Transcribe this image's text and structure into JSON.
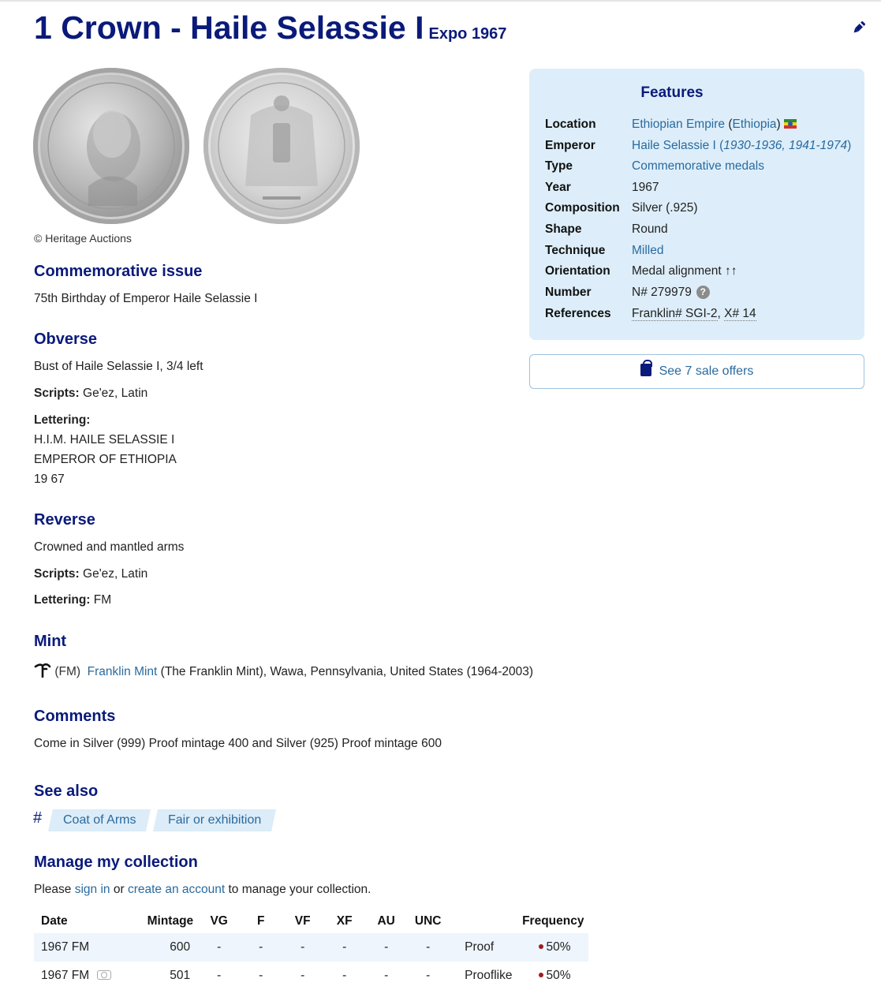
{
  "page": {
    "title": "1 Crown - Haile Selassie I",
    "subtitle": "Expo 1967"
  },
  "images": {
    "credit": "© Heritage Auctions"
  },
  "commemorative": {
    "heading": "Commemorative issue",
    "text": "75th Birthday of Emperor Haile Selassie I"
  },
  "obverse": {
    "heading": "Obverse",
    "description": "Bust of Haile Selassie I, 3/4 left",
    "scripts_label": "Scripts:",
    "scripts": "Ge'ez, Latin",
    "lettering_label": "Lettering:",
    "lettering_lines": [
      "H.I.M. HAILE SELASSIE I",
      "EMPEROR OF ETHIOPIA",
      "19 67"
    ]
  },
  "reverse": {
    "heading": "Reverse",
    "description": "Crowned and mantled arms",
    "scripts_label": "Scripts:",
    "scripts": "Ge'ez, Latin",
    "lettering_label": "Lettering:",
    "lettering": "FM"
  },
  "mint": {
    "heading": "Mint",
    "mark": "(FM)",
    "name": "Franklin Mint",
    "details": "(The Franklin Mint), Wawa, Pennsylvania, United States (1964-2003)"
  },
  "comments": {
    "heading": "Comments",
    "text": "Come in Silver (999) Proof mintage 400 and Silver (925) Proof mintage 600"
  },
  "see_also": {
    "heading": "See also",
    "hash": "#",
    "tags": [
      "Coat of Arms",
      "Fair or exhibition"
    ]
  },
  "collection": {
    "heading": "Manage my collection",
    "text_prefix": "Please",
    "sign_in": "sign in",
    "or": "or",
    "create_account": "create an account",
    "text_suffix": "to manage your collection."
  },
  "features": {
    "heading": "Features",
    "location_label": "Location",
    "location_value": "Ethiopian Empire",
    "location_paren": "Ethiopia",
    "emperor_label": "Emperor",
    "emperor_value": "Haile Selassie I",
    "emperor_years": "1930-1936, 1941-1974",
    "type_label": "Type",
    "type_value": "Commemorative medals",
    "year_label": "Year",
    "year_value": "1967",
    "composition_label": "Composition",
    "composition_value": "Silver (.925)",
    "shape_label": "Shape",
    "shape_value": "Round",
    "technique_label": "Technique",
    "technique_value": "Milled",
    "orientation_label": "Orientation",
    "orientation_value": "Medal alignment ↑↑",
    "number_label": "Number",
    "number_value": "N# 279979",
    "references_label": "References",
    "ref1": "Franklin# SGI-2",
    "ref2": "X# 14"
  },
  "sale": {
    "label": "See 7 sale offers"
  },
  "table": {
    "headers": [
      "Date",
      "Mintage",
      "VG",
      "F",
      "VF",
      "XF",
      "AU",
      "UNC",
      "",
      "Frequency"
    ],
    "rows": [
      [
        "1967 FM",
        "600",
        "-",
        "-",
        "-",
        "-",
        "-",
        "-",
        "Proof",
        "50%"
      ],
      [
        "1967 FM",
        "501",
        "-",
        "-",
        "-",
        "-",
        "-",
        "-",
        "Prooflike",
        "50%"
      ]
    ]
  },
  "colors": {
    "heading": "#0a1a7a",
    "link": "#2a6a9e",
    "features_bg": "#ddeefa",
    "frequency_dot": "#9b1c1c"
  }
}
